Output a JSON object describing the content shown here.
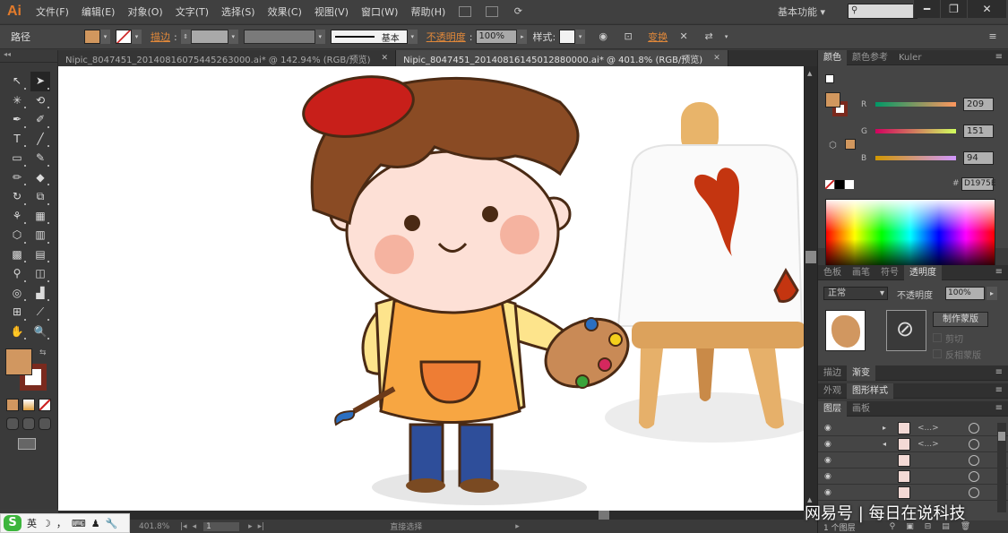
{
  "app": {
    "logo": "Ai",
    "menu": [
      "文件(F)",
      "编辑(E)",
      "对象(O)",
      "文字(T)",
      "选择(S)",
      "效果(C)",
      "视图(V)",
      "窗口(W)",
      "帮助(H)"
    ],
    "workspace": "基本功能",
    "workspace_arrow": "▾",
    "search_icon": "⚲",
    "window_buttons": {
      "minimize": "━",
      "restore": "❐",
      "close": "✕"
    }
  },
  "control_bar": {
    "selection_label": "路径",
    "fill_color": "#D1975E",
    "stroke_label": "描边",
    "stroke_colon": ":",
    "stroke_profile": "基本",
    "opacity_label": "不透明度",
    "opacity_value": "100%",
    "style_label": "样式",
    "transform_label": "变换",
    "dd": "▾",
    "play": "▸",
    "menu_icon": "≡"
  },
  "tabs": [
    {
      "label": "Nipic_8047451_20140816075445263000.ai* @ 142.94% (RGB/预览)",
      "close": "✕",
      "active": false
    },
    {
      "label": "Nipic_8047451_20140816145012880000.ai* @ 401.8% (RGB/预览)",
      "close": "✕",
      "active": true
    }
  ],
  "tools": [
    "↖",
    "➤",
    "✳",
    "⟲",
    "✒",
    "✐",
    "T",
    "╱",
    "▭",
    "✎",
    "✏",
    "◆",
    "↻",
    "⧉",
    "⚘",
    "▦",
    "⬡",
    "▥",
    "▩",
    "▤",
    "⚲",
    "◫",
    "◎",
    "▟",
    "⊞",
    "⟋",
    "✋",
    "🔍"
  ],
  "tool_colors": {
    "fill": "#D1975E",
    "stroke": "#7A2A1E",
    "swap": "⇆"
  },
  "color_panel": {
    "tabs": [
      "颜色",
      "颜色参考",
      "Kuler"
    ],
    "channels": [
      {
        "label": "R",
        "value": "209"
      },
      {
        "label": "G",
        "value": "151"
      },
      {
        "label": "B",
        "value": "94"
      }
    ],
    "hex_label": "#",
    "hex": "D1975E"
  },
  "transparency_panel": {
    "tabs": [
      "色板",
      "画笔",
      "符号",
      "透明度"
    ],
    "blend_mode": "正常",
    "opacity_label": "不透明度",
    "opacity_value": "100%",
    "make_mask_button": "制作蒙版",
    "clip_label": "剪切",
    "invert_label": "反相蒙版",
    "no_mask_icon": "⊘"
  },
  "stroke_tabs": [
    "描边",
    "渐变"
  ],
  "appearance_tabs": [
    "外观",
    "图形样式"
  ],
  "layers_panel": {
    "tabs": [
      "图层",
      "画板"
    ],
    "rows": [
      {
        "expand": "▸",
        "name": "<...>"
      },
      {
        "expand": "◂",
        "name": "<...>"
      },
      {
        "expand": "",
        "name": ""
      },
      {
        "expand": "",
        "name": ""
      },
      {
        "expand": "",
        "name": ""
      }
    ],
    "status": "1 个图层"
  },
  "status_bar": {
    "zoom": "401.8%",
    "page": "1",
    "tool_name": "直接选择"
  },
  "ime": {
    "logo": "S",
    "lang": "英",
    "moon": "☽",
    "punct": "，",
    "keyboard": "⌨",
    "user": "♟",
    "settings": "🔧"
  },
  "watermark": "网易号 | 每日在说科技"
}
